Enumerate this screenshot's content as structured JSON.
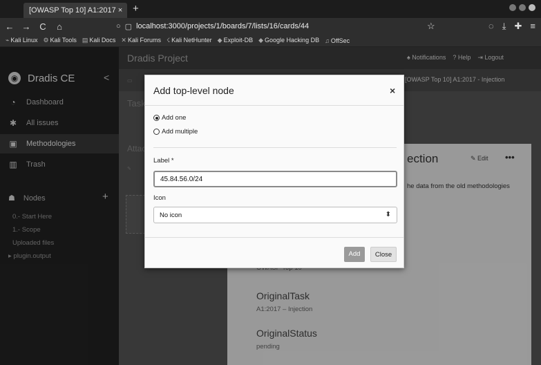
{
  "browser": {
    "tab_title": "[OWASP Top 10] A1:2017 ×",
    "new_tab": "+",
    "url": "localhost:3000/projects/1/boards/7/lists/16/cards/44",
    "bookmarks": [
      "Kali Linux",
      "Kali Tools",
      "Kali Docs",
      "Kali Forums",
      "Kali NetHunter",
      "Exploit-DB",
      "Google Hacking DB",
      "OffSec"
    ]
  },
  "sidebar": {
    "brand": "Dradis CE",
    "collapse": "<",
    "items": [
      {
        "icon": "dashboard-icon",
        "glyph": "◔",
        "label": "Dashboard"
      },
      {
        "icon": "issues-icon",
        "glyph": "✱",
        "label": "All issues"
      },
      {
        "icon": "methodology-icon",
        "glyph": "▣",
        "label": "Methodologies"
      },
      {
        "icon": "trash-icon",
        "glyph": "▥",
        "label": "Trash"
      }
    ],
    "nodes_label": "Nodes",
    "nodes_add": "+",
    "node_links": [
      "0.- Start Here",
      "1.- Scope",
      "Uploaded files",
      "▸ plugin.output"
    ]
  },
  "topbar": {
    "project": "Dradis Project",
    "notifications": "Notifications",
    "help": "Help",
    "logout": "Logout"
  },
  "main": {
    "breadcrumb": "[OWASP Top 10] A1:2017 - Injection",
    "tasks_title": "Tasks",
    "attachments_title": "Attac",
    "card": {
      "title": "ection",
      "edit": "Edit",
      "more": "•••",
      "note": "he data from the old methodologies",
      "fields": [
        {
          "label": "",
          "value": "OWASP Top 10"
        },
        {
          "label": "OriginalTask",
          "value": "A1:2017 – Injection"
        },
        {
          "label": "OriginalStatus",
          "value": "pending"
        }
      ]
    }
  },
  "modal": {
    "title": "Add top-level node",
    "close": "×",
    "radio_one": "Add one",
    "radio_multiple": "Add multiple",
    "label_field": "Label *",
    "label_value": "45.84.56.0/24",
    "icon_field": "Icon",
    "icon_value": "No icon",
    "add_button": "Add",
    "close_button": "Close"
  }
}
